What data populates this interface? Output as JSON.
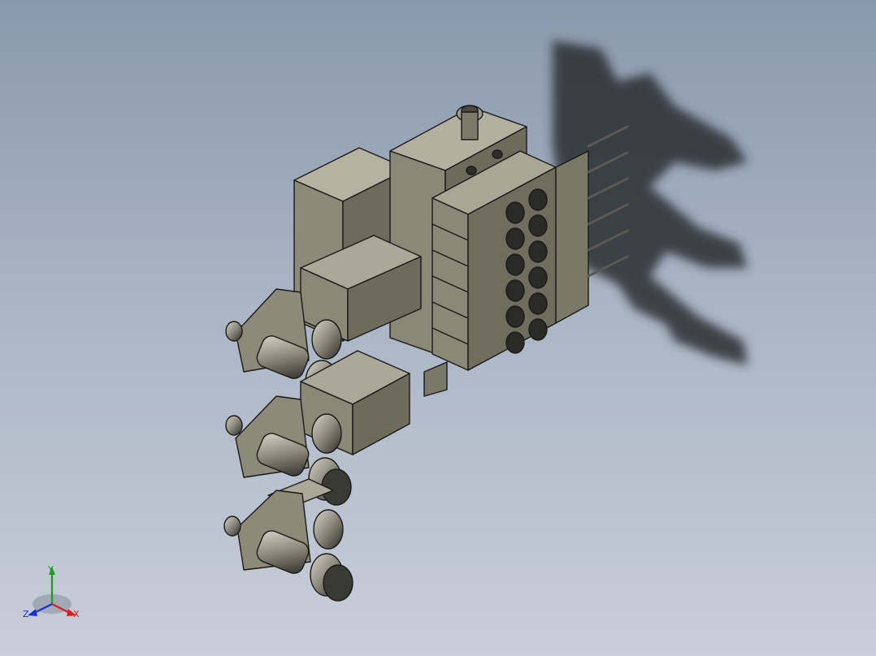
{
  "viewport": {
    "background_top": "#8a99ad",
    "background_bottom": "#c9ced9",
    "part_color": "#8c8a78",
    "shadow_color": "#2a2d33"
  },
  "triad": {
    "x_label": "X",
    "y_label": "Y",
    "z_label": "Z",
    "x_color": "#d42020",
    "y_color": "#1aa01a",
    "z_color": "#2030d0"
  }
}
